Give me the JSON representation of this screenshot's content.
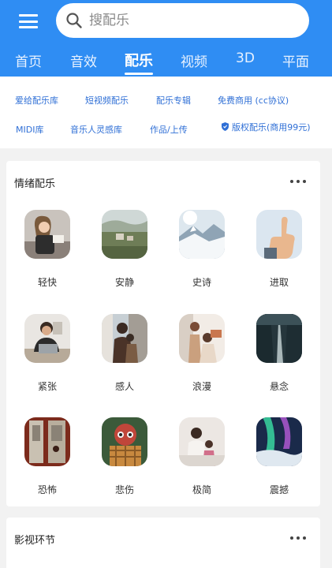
{
  "header": {
    "search_placeholder": "搜配乐",
    "tabs": [
      "首页",
      "音效",
      "配乐",
      "视频",
      "3D",
      "平面"
    ],
    "active_tab": "配乐"
  },
  "quick_links": {
    "row1": [
      "爱给配乐库",
      "短视频配乐",
      "配乐专辑",
      "免费商用 (cc协议)"
    ],
    "row2": [
      "MIDI库",
      "音乐人灵感库",
      "作品/上传",
      "版权配乐(商用99元)"
    ]
  },
  "sections": {
    "emotion": {
      "title": "情绪配乐",
      "moods": [
        "轻快",
        "安静",
        "史诗",
        "进取",
        "紧张",
        "感人",
        "浪漫",
        "悬念",
        "恐怖",
        "悲伤",
        "极简",
        "震撼"
      ]
    },
    "film": {
      "title": "影视环节"
    }
  },
  "colors": {
    "brand_blue": "#2f8df3",
    "link_blue": "#2f6fd6"
  }
}
